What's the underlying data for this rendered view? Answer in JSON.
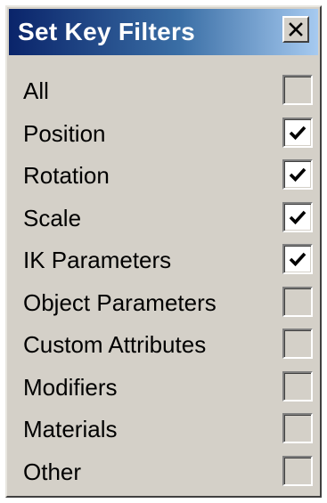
{
  "dialog": {
    "title": "Set Key Filters",
    "close_icon": "close-icon"
  },
  "filters": [
    {
      "label": "All",
      "checked": false
    },
    {
      "label": "Position",
      "checked": true
    },
    {
      "label": "Rotation",
      "checked": true
    },
    {
      "label": "Scale",
      "checked": true
    },
    {
      "label": "IK Parameters",
      "checked": true
    },
    {
      "label": "Object Parameters",
      "checked": false
    },
    {
      "label": "Custom Attributes",
      "checked": false
    },
    {
      "label": "Modifiers",
      "checked": false
    },
    {
      "label": "Materials",
      "checked": false
    },
    {
      "label": "Other",
      "checked": false
    }
  ],
  "colors": {
    "titlebar_start": "#0a246a",
    "titlebar_end": "#a6caf0",
    "face": "#d4d0c8"
  }
}
